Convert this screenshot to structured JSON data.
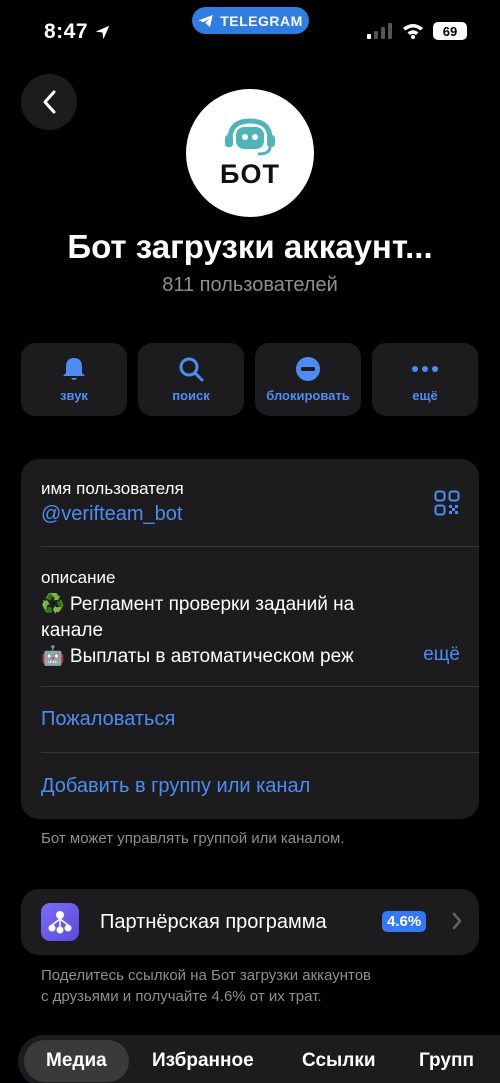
{
  "status_bar": {
    "time": "8:47",
    "pill_label": "TELEGRAM",
    "battery": "69"
  },
  "header": {
    "avatar_text": "БОТ",
    "title": "Бот загрузки аккаунт...",
    "subtitle": "811 пользователей"
  },
  "actions": [
    {
      "label": "звук",
      "icon": "bell-icon"
    },
    {
      "label": "поиск",
      "icon": "search-icon"
    },
    {
      "label": "блокировать",
      "icon": "block-icon"
    },
    {
      "label": "ещё",
      "icon": "more-icon"
    }
  ],
  "info": {
    "username_label": "имя пользователя",
    "username": "@verifteam_bot",
    "description_label": "описание",
    "description_lines": [
      "♻️ Регламент проверки заданий на",
      "канале",
      "🤖 Выплаты в автоматическом реж"
    ],
    "more_label": "ещё",
    "report_label": "Пожаловаться",
    "add_label": "Добавить в группу или канал"
  },
  "note": "Бот может управлять группой или каналом.",
  "partner": {
    "label": "Партнёрская программа",
    "badge": "4.6%",
    "note_lines": [
      "Поделитесь ссылкой на Бот загрузки аккаунтов",
      "с друзьями и получайте 4.6% от их трат."
    ]
  },
  "tabs": [
    "Медиа",
    "Избранное",
    "Ссылки",
    "Групп"
  ],
  "colors": {
    "accent": "#4c8df5",
    "card": "#1c1c1e",
    "background": "#000000",
    "secondary_text": "#8e8e93"
  }
}
